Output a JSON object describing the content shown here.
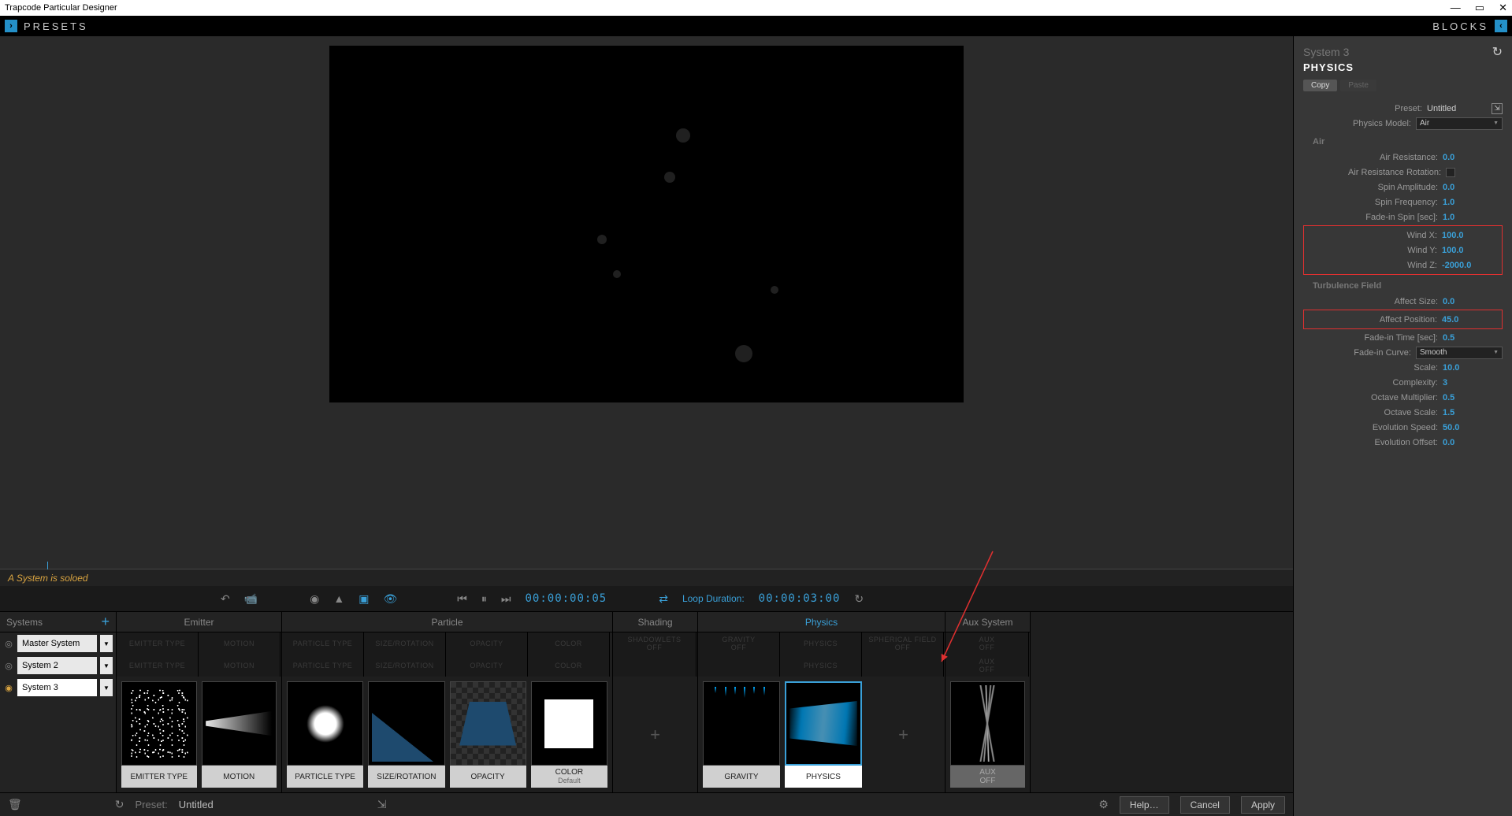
{
  "window": {
    "title": "Trapcode Particular Designer"
  },
  "topbar": {
    "presets": "PRESETS",
    "blocks": "BLOCKS"
  },
  "preview": {
    "solo_msg": "A System is soloed",
    "timecode": "00:00:00:05",
    "loop_label": "Loop Duration:",
    "loop_time": "00:00:03:00"
  },
  "systems": {
    "header": "Systems",
    "items": [
      "Master System",
      "System 2",
      "System 3"
    ]
  },
  "groups": {
    "emitter": "Emitter",
    "particle": "Particle",
    "shading": "Shading",
    "physics": "Physics",
    "aux": "Aux System"
  },
  "ghost_cells": {
    "emitter_type": "EMITTER TYPE",
    "motion": "MOTION",
    "particle_type": "PARTICLE TYPE",
    "size_rot": "SIZE/ROTATION",
    "opacity": "OPACITY",
    "color": "COLOR",
    "shadow": "SHADOWLETS",
    "shadow2": "OFF",
    "gravity": "GRAVITY",
    "gravity2": "OFF",
    "physics": "PHYSICS",
    "sph": "SPHERICAL FIELD",
    "sph2": "OFF",
    "aux": "AUX",
    "aux2": "OFF"
  },
  "tiles": {
    "emitter_type": "EMITTER TYPE",
    "motion": "MOTION",
    "particle_type": "PARTICLE TYPE",
    "size_rotation": "SIZE/ROTATION",
    "opacity": "OPACITY",
    "color": "COLOR",
    "color_sub": "Default",
    "gravity": "GRAVITY",
    "physics": "PHYSICS",
    "aux": "AUX",
    "aux_sub": "OFF"
  },
  "panel": {
    "system": "System 3",
    "section": "PHYSICS",
    "copy": "Copy",
    "paste": "Paste",
    "preset_lbl": "Preset:",
    "preset_val": "Untitled",
    "model_lbl": "Physics Model:",
    "model_val": "Air",
    "air_head": "Air",
    "air_res_lbl": "Air Resistance:",
    "air_res_val": "0.0",
    "air_rot_lbl": "Air Resistance Rotation:",
    "spin_amp_lbl": "Spin Amplitude:",
    "spin_amp_val": "0.0",
    "spin_freq_lbl": "Spin Frequency:",
    "spin_freq_val": "1.0",
    "fade_spin_lbl": "Fade-in Spin [sec]:",
    "fade_spin_val": "1.0",
    "windx_lbl": "Wind X:",
    "windx_val": "100.0",
    "windy_lbl": "Wind Y:",
    "windy_val": "100.0",
    "windz_lbl": "Wind Z:",
    "windz_val": "-2000.0",
    "turb_head": "Turbulence Field",
    "aff_size_lbl": "Affect Size:",
    "aff_size_val": "0.0",
    "aff_pos_lbl": "Affect Position:",
    "aff_pos_val": "45.0",
    "fade_time_lbl": "Fade-in Time [sec]:",
    "fade_time_val": "0.5",
    "fade_curve_lbl": "Fade-in Curve:",
    "fade_curve_val": "Smooth",
    "scale_lbl": "Scale:",
    "scale_val": "10.0",
    "complex_lbl": "Complexity:",
    "complex_val": "3",
    "oct_mult_lbl": "Octave Multiplier:",
    "oct_mult_val": "0.5",
    "oct_scale_lbl": "Octave Scale:",
    "oct_scale_val": "1.5",
    "evo_speed_lbl": "Evolution Speed:",
    "evo_speed_val": "50.0",
    "evo_off_lbl": "Evolution Offset:",
    "evo_off_val": "0.0"
  },
  "bottom": {
    "preset_lbl": "Preset:",
    "preset_val": "Untitled",
    "help": "Help…",
    "cancel": "Cancel",
    "apply": "Apply"
  }
}
